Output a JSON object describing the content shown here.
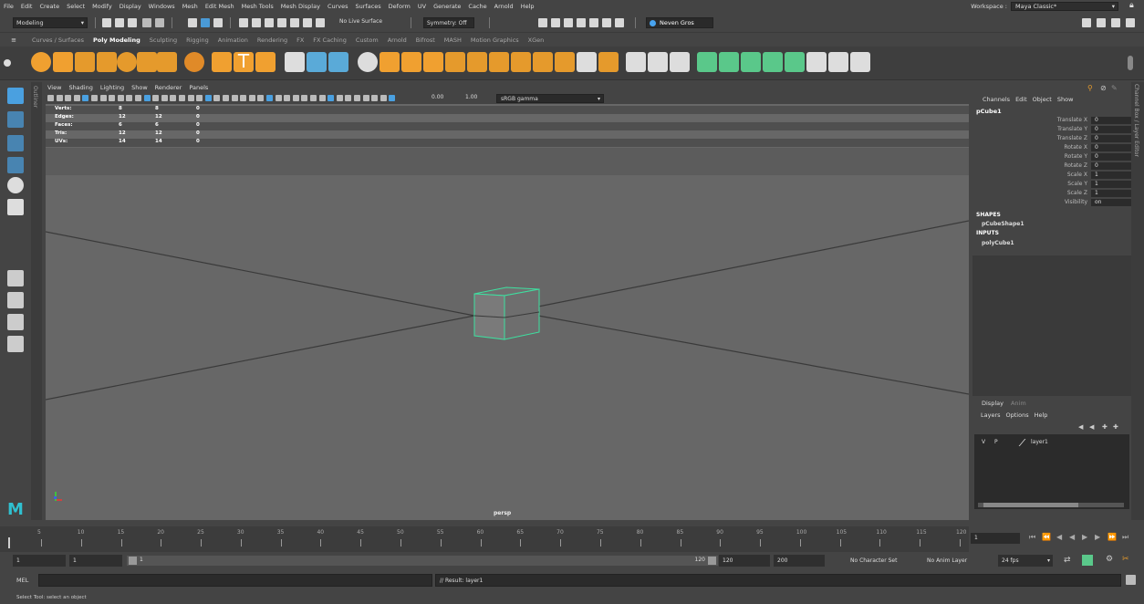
{
  "menubar": {
    "items": [
      "File",
      "Edit",
      "Create",
      "Select",
      "Modify",
      "Display",
      "Windows",
      "Mesh",
      "Edit Mesh",
      "Mesh Tools",
      "Mesh Display",
      "Curves",
      "Surfaces",
      "Deform",
      "UV",
      "Generate",
      "Cache",
      "Arnold",
      "Help"
    ],
    "workspace_label": "Workspace :",
    "workspace_value": "Maya Classic*"
  },
  "statusline": {
    "mode": "Modeling",
    "live_surface": "No Live Surface",
    "symmetry": "Symmetry: Off",
    "user": "Neven Gros"
  },
  "shelf_tabs": {
    "items": [
      "Curves / Surfaces",
      "Poly Modeling",
      "Sculpting",
      "Rigging",
      "Animation",
      "Rendering",
      "FX",
      "FX Caching",
      "Custom",
      "Arnold",
      "Bifrost",
      "MASH",
      "Motion Graphics",
      "XGen"
    ],
    "active": "Poly Modeling"
  },
  "outliner_strip": {
    "label": "Outliner"
  },
  "viewport": {
    "menu": [
      "View",
      "Shading",
      "Lighting",
      "Show",
      "Renderer",
      "Panels"
    ],
    "exposure": "0.00",
    "gamma_value": "1.00",
    "color_space": "sRGB gamma",
    "hud": [
      {
        "label": "Verts:",
        "a": "8",
        "b": "8",
        "c": "0"
      },
      {
        "label": "Edges:",
        "a": "12",
        "b": "12",
        "c": "0"
      },
      {
        "label": "Faces:",
        "a": "6",
        "b": "6",
        "c": "0"
      },
      {
        "label": "Tris:",
        "a": "12",
        "b": "12",
        "c": "0"
      },
      {
        "label": "UVs:",
        "a": "14",
        "b": "14",
        "c": "0"
      }
    ],
    "camera": "persp"
  },
  "channelbox": {
    "menu": [
      "Channels",
      "Edit",
      "Object",
      "Show"
    ],
    "object": "pCube1",
    "attrs": [
      {
        "name": "Translate X",
        "value": "0"
      },
      {
        "name": "Translate Y",
        "value": "0"
      },
      {
        "name": "Translate Z",
        "value": "0"
      },
      {
        "name": "Rotate X",
        "value": "0"
      },
      {
        "name": "Rotate Y",
        "value": "0"
      },
      {
        "name": "Rotate Z",
        "value": "0"
      },
      {
        "name": "Scale X",
        "value": "1"
      },
      {
        "name": "Scale Y",
        "value": "1"
      },
      {
        "name": "Scale Z",
        "value": "1"
      },
      {
        "name": "Visibility",
        "value": "on"
      }
    ],
    "shapes_header": "SHAPES",
    "shape": "pCubeShape1",
    "inputs_header": "INPUTS",
    "input": "polyCube1",
    "side_label": "Channel Box / Layer Editor"
  },
  "layers": {
    "tabs": [
      "Display",
      "Anim"
    ],
    "menu": [
      "Layers",
      "Options",
      "Help"
    ],
    "row": {
      "v": "V",
      "p": "P",
      "name": "layer1"
    }
  },
  "timeslider": {
    "ticks": [
      "5",
      "10",
      "15",
      "20",
      "25",
      "30",
      "35",
      "40",
      "45",
      "50",
      "55",
      "60",
      "65",
      "70",
      "75",
      "80",
      "85",
      "90",
      "95",
      "100",
      "105",
      "110",
      "115",
      "120"
    ],
    "current_frame": "1"
  },
  "range": {
    "start": "1",
    "start_inner": "1",
    "slider_start": "1",
    "slider_end": "120",
    "end_inner": "120",
    "end": "200",
    "char_set": "No Character Set",
    "anim_layer": "No Anim Layer",
    "fps": "24 fps"
  },
  "cmdline": {
    "lang": "MEL",
    "result": "// Result: layer1"
  },
  "helpline": "Select Tool: select an object"
}
